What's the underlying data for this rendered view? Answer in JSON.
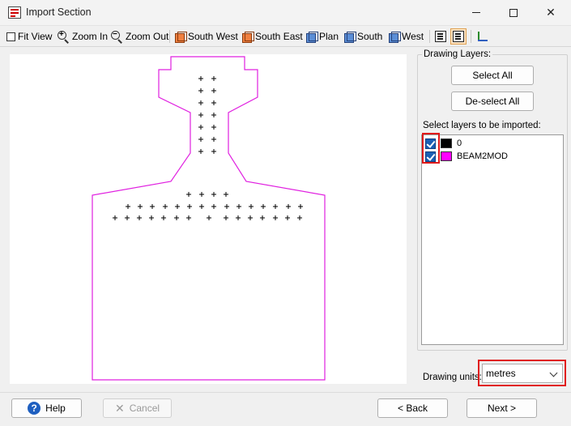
{
  "window": {
    "title": "Import Section",
    "icon": "import-section-app-icon",
    "controls": [
      "minimize-icon",
      "maximize-icon",
      "close-icon"
    ]
  },
  "toolbar": {
    "items": [
      {
        "label": "Fit View",
        "icon": "fit-view-icon"
      },
      {
        "label": "Zoom In",
        "icon": "zoom-in-icon"
      },
      {
        "label": "Zoom Out",
        "icon": "zoom-out-icon"
      },
      {
        "label": "South West",
        "icon": "cube-view-icon"
      },
      {
        "label": "South East",
        "icon": "cube-view-icon"
      },
      {
        "label": "Plan",
        "icon": "cube-view-icon"
      },
      {
        "label": "South",
        "icon": "cube-view-icon"
      },
      {
        "label": "West",
        "icon": "cube-view-icon"
      }
    ],
    "extra_icons": [
      "list-view-icon",
      "list-view-active-icon",
      "axes-icon"
    ]
  },
  "colors": {
    "section_outline": "#e020e0",
    "layer_0": "#000000",
    "layer_beam2mod": "#ff00ff",
    "highlight": "#e01a1a"
  },
  "layers_panel": {
    "group_title": "Drawing Layers:",
    "select_all": "Select All",
    "deselect_all": "De-select All",
    "list_title": "Select layers to be imported:",
    "layers": [
      {
        "name": "0",
        "checked": true,
        "color": "#000000"
      },
      {
        "name": "BEAM2MOD",
        "checked": true,
        "color": "#ff00ff"
      }
    ]
  },
  "units": {
    "label": "Drawing units:",
    "value": "metres"
  },
  "footer": {
    "help": "Help",
    "cancel": "Cancel",
    "back": "< Back",
    "next": "Next >"
  }
}
